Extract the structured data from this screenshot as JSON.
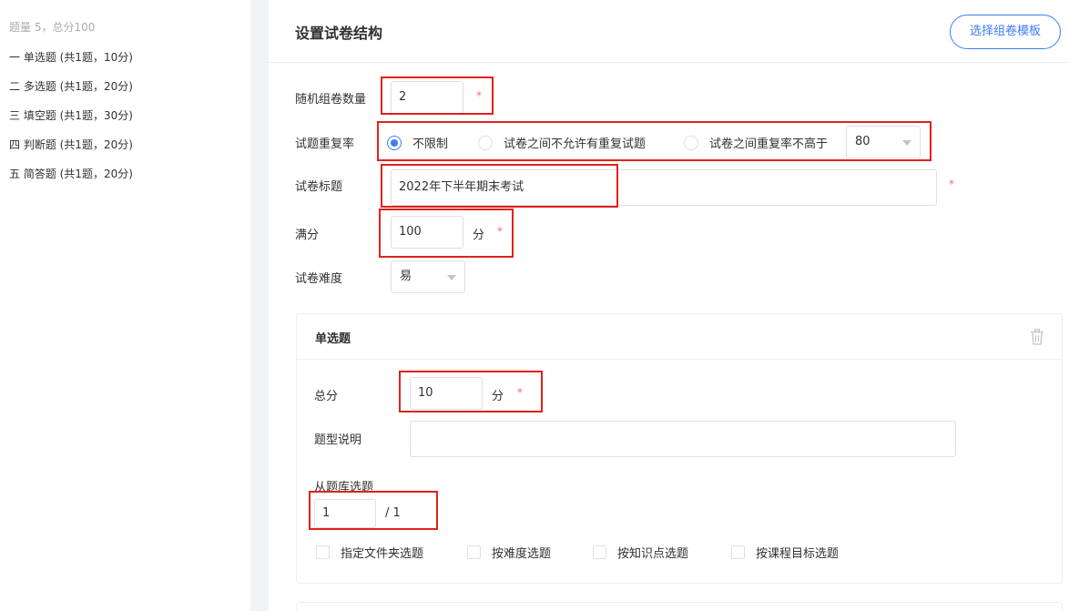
{
  "sidebar": {
    "summary": "题量 5，总分100",
    "items": [
      {
        "label": "一 单选题 (共1题，10分)"
      },
      {
        "label": "二 多选题 (共1题，20分)"
      },
      {
        "label": "三 填空题 (共1题，30分)"
      },
      {
        "label": "四 判断题 (共1题，20分)"
      },
      {
        "label": "五 简答题 (共1题，20分)"
      }
    ]
  },
  "header": {
    "title": "设置试卷结构",
    "template_button": "选择组卷模板"
  },
  "form": {
    "random_count": {
      "label": "随机组卷数量",
      "value": "2",
      "required": "*"
    },
    "repeat_rate": {
      "label": "试题重复率",
      "options": [
        "不限制",
        "试卷之间不允许有重复试题",
        "试卷之间重复率不高于"
      ],
      "selected": "不限制",
      "threshold": "80"
    },
    "paper_title": {
      "label": "试卷标题",
      "value": "2022年下半年期末考试",
      "required": "*"
    },
    "full_score": {
      "label": "满分",
      "value": "100",
      "unit": "分",
      "required": "*"
    },
    "difficulty": {
      "label": "试卷难度",
      "value": "易"
    }
  },
  "section": {
    "title": "单选题",
    "total_score": {
      "label": "总分",
      "value": "10",
      "unit": "分",
      "required": "*"
    },
    "description": {
      "label": "题型说明",
      "value": ""
    },
    "bank_select": {
      "label": "从题库选题",
      "value": "1",
      "total": "/ 1"
    },
    "filters": [
      "指定文件夹选题",
      "按难度选题",
      "按知识点选题",
      "按课程目标选题"
    ]
  },
  "colors": {
    "accent": "#3d7df5",
    "required": "#f56c6c",
    "highlight": "#e0221b"
  }
}
